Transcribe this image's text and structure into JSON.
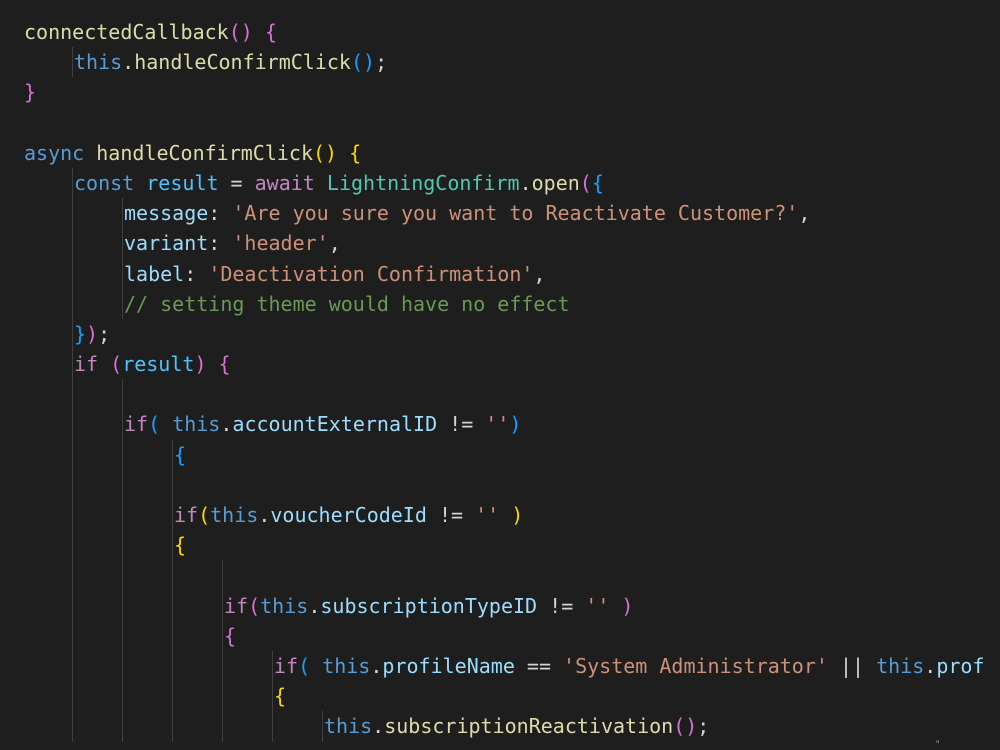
{
  "colors": {
    "background": "#1e1e1e",
    "function": "#dcdcaa",
    "keyword_blue": "#569cd6",
    "control_purple": "#c586c0",
    "variable": "#9cdcfe",
    "constant": "#4fc1ff",
    "class": "#4ec9b0",
    "string": "#ce9178",
    "comment": "#6a9955",
    "punctuation": "#d4d4d4",
    "bracket_gold": "#ffd700",
    "bracket_purple": "#da70d6",
    "bracket_blue": "#179fff"
  },
  "lines": [
    {
      "indent": 0,
      "tokens": [
        {
          "t": "connectedCallback",
          "c": "function"
        },
        {
          "t": "()",
          "c": "bracket_purple"
        },
        {
          "t": " ",
          "c": "punctuation"
        },
        {
          "t": "{",
          "c": "bracket_purple"
        }
      ]
    },
    {
      "indent": 1,
      "tokens": [
        {
          "t": "this",
          "c": "keyword_blue"
        },
        {
          "t": ".",
          "c": "punctuation"
        },
        {
          "t": "handleConfirmClick",
          "c": "function"
        },
        {
          "t": "()",
          "c": "bracket_blue"
        },
        {
          "t": ";",
          "c": "punctuation"
        }
      ]
    },
    {
      "indent": 0,
      "tokens": [
        {
          "t": "}",
          "c": "bracket_purple"
        }
      ]
    },
    {
      "indent": 0,
      "tokens": []
    },
    {
      "indent": 0,
      "tokens": [
        {
          "t": "async",
          "c": "keyword_blue"
        },
        {
          "t": " ",
          "c": "punctuation"
        },
        {
          "t": "handleConfirmClick",
          "c": "function"
        },
        {
          "t": "()",
          "c": "bracket_gold"
        },
        {
          "t": " ",
          "c": "punctuation"
        },
        {
          "t": "{",
          "c": "bracket_gold"
        }
      ]
    },
    {
      "indent": 1,
      "tokens": [
        {
          "t": "const",
          "c": "keyword_blue"
        },
        {
          "t": " ",
          "c": "punctuation"
        },
        {
          "t": "result",
          "c": "constant"
        },
        {
          "t": " = ",
          "c": "punctuation"
        },
        {
          "t": "await",
          "c": "control_purple"
        },
        {
          "t": " ",
          "c": "punctuation"
        },
        {
          "t": "LightningConfirm",
          "c": "class"
        },
        {
          "t": ".",
          "c": "punctuation"
        },
        {
          "t": "open",
          "c": "function"
        },
        {
          "t": "(",
          "c": "bracket_purple"
        },
        {
          "t": "{",
          "c": "bracket_blue"
        }
      ]
    },
    {
      "indent": 2,
      "tokens": [
        {
          "t": "message",
          "c": "variable"
        },
        {
          "t": ": ",
          "c": "punctuation"
        },
        {
          "t": "'Are you sure you want to Reactivate Customer?'",
          "c": "string"
        },
        {
          "t": ",",
          "c": "punctuation"
        }
      ]
    },
    {
      "indent": 2,
      "tokens": [
        {
          "t": "variant",
          "c": "variable"
        },
        {
          "t": ": ",
          "c": "punctuation"
        },
        {
          "t": "'header'",
          "c": "string"
        },
        {
          "t": ",",
          "c": "punctuation"
        }
      ]
    },
    {
      "indent": 2,
      "tokens": [
        {
          "t": "label",
          "c": "variable"
        },
        {
          "t": ": ",
          "c": "punctuation"
        },
        {
          "t": "'Deactivation Confirmation'",
          "c": "string"
        },
        {
          "t": ",",
          "c": "punctuation"
        }
      ]
    },
    {
      "indent": 2,
      "tokens": [
        {
          "t": "// setting theme would have no effect",
          "c": "comment"
        }
      ]
    },
    {
      "indent": 1,
      "tokens": [
        {
          "t": "}",
          "c": "bracket_blue"
        },
        {
          "t": ")",
          "c": "bracket_purple"
        },
        {
          "t": ";",
          "c": "punctuation"
        }
      ]
    },
    {
      "indent": 1,
      "tokens": [
        {
          "t": "if",
          "c": "control_purple"
        },
        {
          "t": " ",
          "c": "punctuation"
        },
        {
          "t": "(",
          "c": "bracket_purple"
        },
        {
          "t": "result",
          "c": "constant"
        },
        {
          "t": ")",
          "c": "bracket_purple"
        },
        {
          "t": " ",
          "c": "punctuation"
        },
        {
          "t": "{",
          "c": "bracket_purple"
        }
      ]
    },
    {
      "indent": 2,
      "tokens": []
    },
    {
      "indent": 2,
      "tokens": [
        {
          "t": "if",
          "c": "control_purple"
        },
        {
          "t": "(",
          "c": "bracket_blue"
        },
        {
          "t": " ",
          "c": "punctuation"
        },
        {
          "t": "this",
          "c": "keyword_blue"
        },
        {
          "t": ".",
          "c": "punctuation"
        },
        {
          "t": "accountExternalID",
          "c": "variable"
        },
        {
          "t": " != ",
          "c": "punctuation"
        },
        {
          "t": "''",
          "c": "string"
        },
        {
          "t": ")",
          "c": "bracket_blue"
        }
      ]
    },
    {
      "indent": 3,
      "tokens": [
        {
          "t": "{",
          "c": "bracket_blue"
        }
      ]
    },
    {
      "indent": 3,
      "tokens": []
    },
    {
      "indent": 3,
      "tokens": [
        {
          "t": "if",
          "c": "control_purple"
        },
        {
          "t": "(",
          "c": "bracket_gold"
        },
        {
          "t": "this",
          "c": "keyword_blue"
        },
        {
          "t": ".",
          "c": "punctuation"
        },
        {
          "t": "voucherCodeId",
          "c": "variable"
        },
        {
          "t": " != ",
          "c": "punctuation"
        },
        {
          "t": "''",
          "c": "string"
        },
        {
          "t": " ",
          "c": "punctuation"
        },
        {
          "t": ")",
          "c": "bracket_gold"
        }
      ]
    },
    {
      "indent": 3,
      "tokens": [
        {
          "t": "{",
          "c": "bracket_gold"
        }
      ]
    },
    {
      "indent": 4,
      "tokens": []
    },
    {
      "indent": 4,
      "tokens": [
        {
          "t": "if",
          "c": "control_purple"
        },
        {
          "t": "(",
          "c": "bracket_purple"
        },
        {
          "t": "this",
          "c": "keyword_blue"
        },
        {
          "t": ".",
          "c": "punctuation"
        },
        {
          "t": "subscriptionTypeID",
          "c": "variable"
        },
        {
          "t": " != ",
          "c": "punctuation"
        },
        {
          "t": "''",
          "c": "string"
        },
        {
          "t": " ",
          "c": "punctuation"
        },
        {
          "t": ")",
          "c": "bracket_purple"
        }
      ]
    },
    {
      "indent": 4,
      "tokens": [
        {
          "t": "{",
          "c": "bracket_purple"
        }
      ]
    },
    {
      "indent": 5,
      "tokens": [
        {
          "t": "if",
          "c": "control_purple"
        },
        {
          "t": "(",
          "c": "bracket_blue"
        },
        {
          "t": " ",
          "c": "punctuation"
        },
        {
          "t": "this",
          "c": "keyword_blue"
        },
        {
          "t": ".",
          "c": "punctuation"
        },
        {
          "t": "profileName",
          "c": "variable"
        },
        {
          "t": " == ",
          "c": "punctuation"
        },
        {
          "t": "'System Administrator'",
          "c": "string"
        },
        {
          "t": " || ",
          "c": "punctuation"
        },
        {
          "t": "this",
          "c": "keyword_blue"
        },
        {
          "t": ".",
          "c": "punctuation"
        },
        {
          "t": "prof",
          "c": "variable"
        }
      ]
    },
    {
      "indent": 5,
      "tokens": [
        {
          "t": "{",
          "c": "bracket_gold"
        }
      ]
    },
    {
      "indent": 6,
      "tokens": [
        {
          "t": "this",
          "c": "keyword_blue"
        },
        {
          "t": ".",
          "c": "punctuation"
        },
        {
          "t": "subscriptionReactivation",
          "c": "function"
        },
        {
          "t": "()",
          "c": "bracket_purple"
        },
        {
          "t": ";",
          "c": "punctuation"
        }
      ]
    }
  ]
}
